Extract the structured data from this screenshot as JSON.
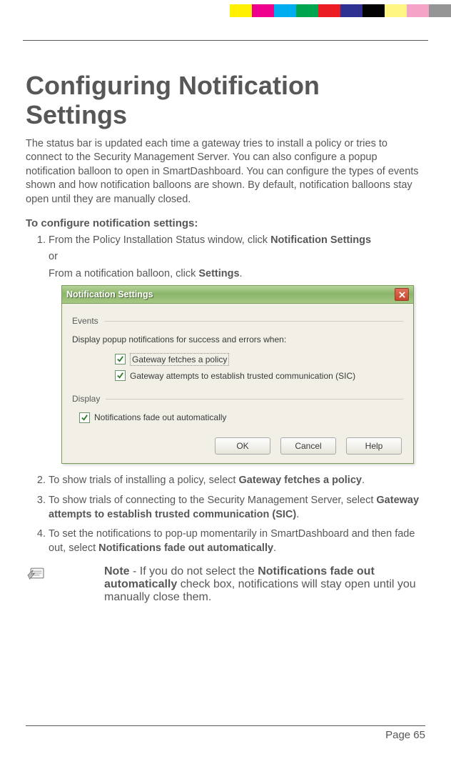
{
  "colorBar": [
    "#fff100",
    "#ed008c",
    "#00adee",
    "#00a54f",
    "#ec1c24",
    "#2e3192",
    "#030303",
    "#fff683",
    "#f5a3c7",
    "#959595"
  ],
  "heading": "Configuring Notification Settings",
  "intro": "The status bar is updated each time a gateway tries to install a policy or tries to connect to the Security Management Server. You can also configure a popup notification balloon to open in SmartDashboard. You can configure the types of events shown and how notification balloons are shown. By default, notification balloons stay open until they are manually closed.",
  "subhead": "To configure notification settings:",
  "steps": {
    "s1a": "From the Policy Installation Status window, click ",
    "s1aBold": "Notification Settings",
    "s1or": "or",
    "s1b": "From a notification balloon, click ",
    "s1bBold": "Settings",
    "s1bEnd": ".",
    "s2a": "To show trials of installing a policy, select ",
    "s2aBold": "Gateway fetches a policy",
    "s2aEnd": ".",
    "s3a": "To show trials of connecting to the Security Management Server, select ",
    "s3aBold": "Gateway attempts to establish trusted communication (SIC)",
    "s3aEnd": ".",
    "s4a": "To set the notifications to pop-up momentarily in SmartDashboard and then fade out, select ",
    "s4aBold": "Notifications fade out automatically",
    "s4aEnd": "."
  },
  "dialog": {
    "title": "Notification Settings",
    "eventsLabel": "Events",
    "eventsDesc": "Display popup notifications for success and errors when:",
    "cb1": "Gateway fetches a policy",
    "cb2": "Gateway attempts to establish trusted communication (SIC)",
    "displayLabel": "Display",
    "cb3": "Notifications fade out automatically",
    "ok": "OK",
    "cancel": "Cancel",
    "help": "Help"
  },
  "note": {
    "lead": "Note",
    "dash": " - If you do not select the ",
    "bold": "Notifications fade out automatically",
    "rest": " check box, notifications will stay open until you manually close them."
  },
  "pageNum": "Page 65"
}
